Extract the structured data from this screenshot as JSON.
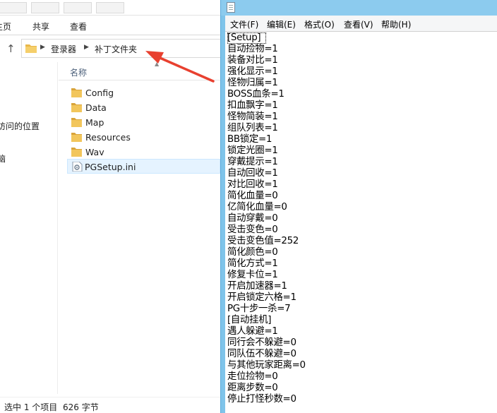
{
  "explorer": {
    "ribbon_tabs": [
      "主页",
      "共享",
      "查看"
    ],
    "address": {
      "crumbs": [
        "登录器",
        "补丁文件夹"
      ]
    },
    "nav_items": [
      "访问的位置",
      "脑"
    ],
    "column_header": "名称",
    "files": [
      {
        "name": "Config",
        "type": "folder"
      },
      {
        "name": "Data",
        "type": "folder"
      },
      {
        "name": "Map",
        "type": "folder"
      },
      {
        "name": "Resources",
        "type": "folder"
      },
      {
        "name": "Wav",
        "type": "folder"
      },
      {
        "name": "PGSetup.ini",
        "type": "ini",
        "selected": true
      }
    ],
    "status": {
      "selection": "选中 1 个项目",
      "size": "626 字节"
    }
  },
  "notepad": {
    "menu": [
      "文件(F)",
      "编辑(E)",
      "格式(O)",
      "查看(V)",
      "帮助(H)"
    ],
    "lines": [
      "[Setup]",
      "自动捡物=1",
      "装备对比=1",
      "强化显示=1",
      "怪物归属=1",
      "BOSS血条=1",
      "扣血飘字=1",
      "怪物简装=1",
      "组队列表=1",
      "BB锁定=1",
      "锁定光圈=1",
      "穿戴提示=1",
      "自动回收=1",
      "对比回收=1",
      "简化血量=0",
      "亿简化血量=0",
      "自动穿戴=0",
      "受击变色=0",
      "受击变色值=252",
      "简化颜色=0",
      "简化方式=1",
      "修复卡位=1",
      "开启加速器=1",
      "开启锁定六格=1",
      "PG十步一杀=7",
      "[自动挂机]",
      "遇人躲避=1",
      "同行会不躲避=0",
      "同队伍不躲避=0",
      "与其他玩家距离=0",
      "走位捡物=0",
      "距离步数=0",
      "停止打怪秒数=0"
    ]
  },
  "colors": {
    "folder": "#e9b84a",
    "selection_bg": "#e5f3ff",
    "notepad_frame": "#7fc4ea",
    "annotation_arrow": "#e8402f"
  }
}
